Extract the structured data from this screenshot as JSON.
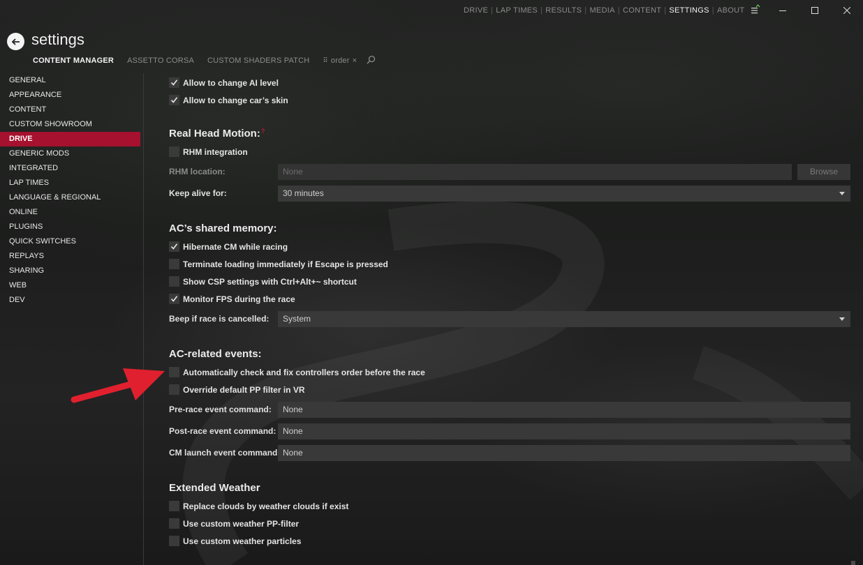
{
  "topnav": {
    "items": [
      "DRIVE",
      "LAP TIMES",
      "RESULTS",
      "MEDIA",
      "CONTENT",
      "SETTINGS",
      "ABOUT"
    ],
    "active": "SETTINGS"
  },
  "header": {
    "title": "settings",
    "tabs": [
      "CONTENT MANAGER",
      "ASSETTO CORSA",
      "CUSTOM SHADERS PATCH"
    ],
    "filter_label": "order"
  },
  "sidebar": {
    "items": [
      {
        "label": "GENERAL"
      },
      {
        "label": "APPEARANCE"
      },
      {
        "label": "CONTENT"
      },
      {
        "label": "CUSTOM SHOWROOM"
      },
      {
        "label": "DRIVE",
        "active": true
      },
      {
        "label": "GENERIC MODS"
      },
      {
        "label": "INTEGRATED"
      },
      {
        "label": "LAP TIMES"
      },
      {
        "label": "LANGUAGE & REGIONAL"
      },
      {
        "label": "ONLINE"
      },
      {
        "label": "PLUGINS"
      },
      {
        "label": "QUICK SWITCHES"
      },
      {
        "label": "REPLAYS"
      },
      {
        "label": "SHARING"
      },
      {
        "label": "WEB"
      },
      {
        "label": "DEV"
      }
    ]
  },
  "main": {
    "top_checks": [
      {
        "label": "Allow to change AI level",
        "checked": true
      },
      {
        "label": "Allow to change car’s skin",
        "checked": true
      }
    ],
    "rhm": {
      "heading": "Real Head Motion:",
      "help_mark": "?",
      "integration": {
        "label": "RHM integration",
        "checked": false
      },
      "location_label": "RHM location:",
      "location_value": "None",
      "browse_label": "Browse",
      "keep_alive_label": "Keep alive for:",
      "keep_alive_value": "30 minutes"
    },
    "shared_memory": {
      "heading": "AC’s shared memory:",
      "checks": [
        {
          "label": "Hibernate CM while racing",
          "checked": true
        },
        {
          "label": "Terminate loading immediately if Escape is pressed",
          "checked": false
        },
        {
          "label": "Show CSP settings with Ctrl+Alt+~ shortcut",
          "checked": false
        },
        {
          "label": "Monitor FPS during the race",
          "checked": true
        }
      ],
      "beep_label": "Beep if race is cancelled:",
      "beep_value": "System"
    },
    "events": {
      "heading": "AC-related events:",
      "checks": [
        {
          "label": "Automatically check and fix controllers order before the race",
          "checked": false
        },
        {
          "label": "Override default PP filter in VR",
          "checked": false
        }
      ],
      "pre_label": "Pre-race event command:",
      "pre_value": "None",
      "post_label": "Post-race event command:",
      "post_value": "None",
      "launch_label": "CM launch event command:",
      "launch_value": "None"
    },
    "weather": {
      "heading": "Extended Weather",
      "checks": [
        {
          "label": "Replace clouds by weather clouds if exist",
          "checked": false
        },
        {
          "label": "Use custom weather PP-filter",
          "checked": false
        },
        {
          "label": "Use custom weather particles",
          "checked": false
        }
      ]
    }
  },
  "colors": {
    "accent": "#a5112e",
    "annotation_arrow": "#e0202e"
  }
}
